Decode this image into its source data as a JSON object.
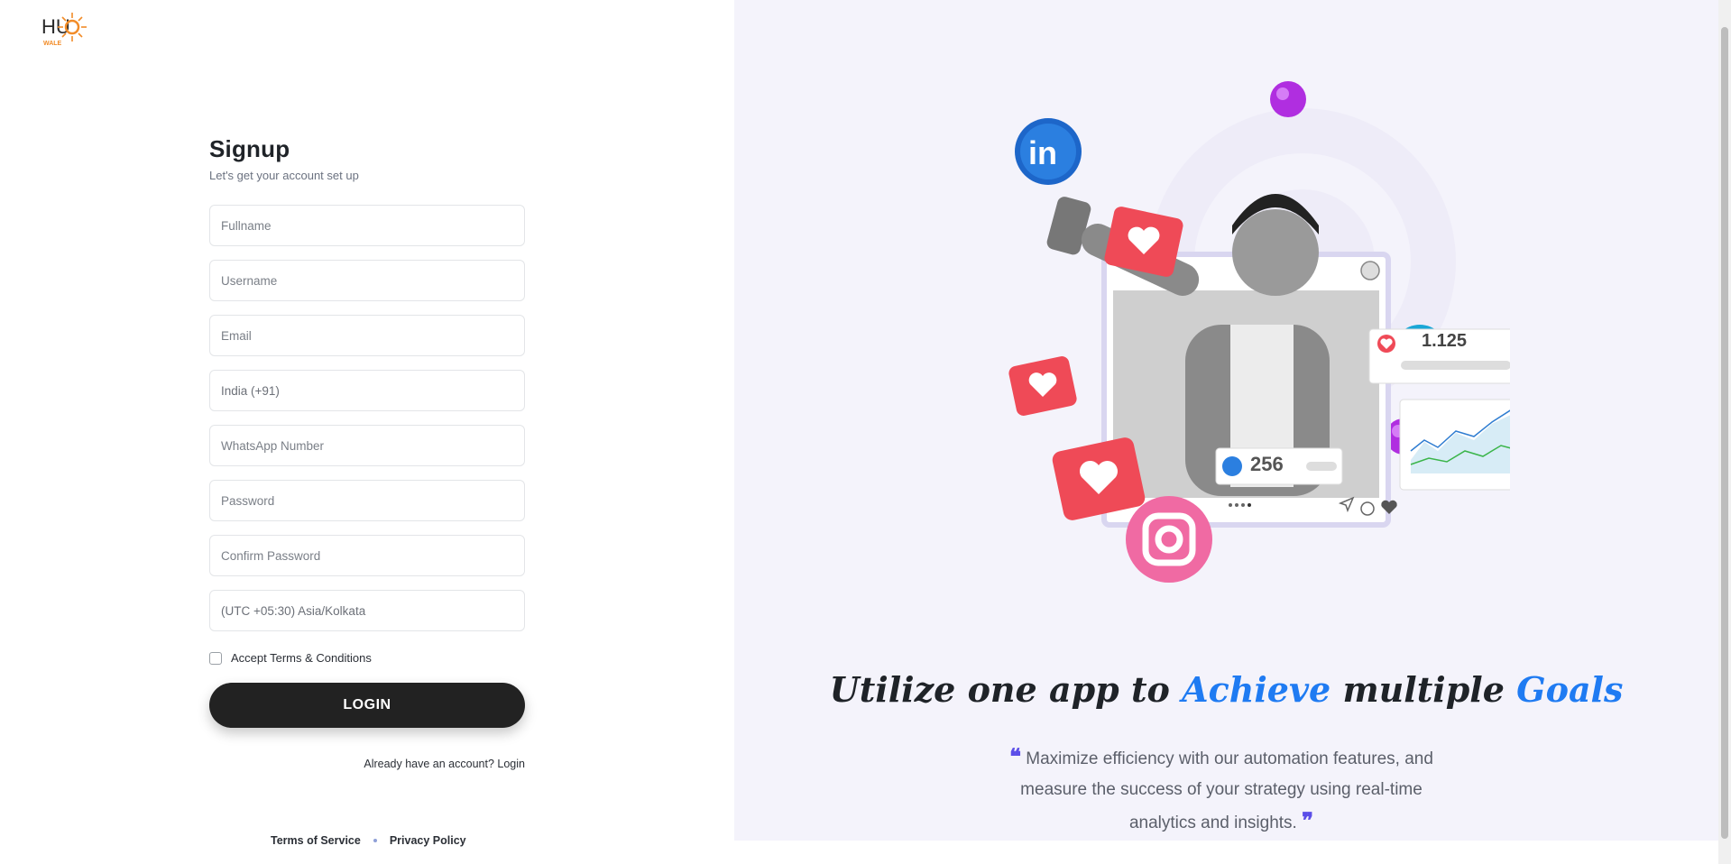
{
  "brand": {
    "logo_main": "HUb",
    "logo_sub": "WALE",
    "accent": "#f28c28"
  },
  "form": {
    "title": "Signup",
    "subtitle": "Let's get your account set up",
    "fields": {
      "fullname": "Fullname",
      "username": "Username",
      "email": "Email",
      "country": "India (+91)",
      "whatsapp": "WhatsApp Number",
      "password": "Password",
      "confirm_password": "Confirm Password",
      "timezone": "(UTC +05:30) Asia/Kolkata"
    },
    "terms_label": "Accept Terms & Conditions",
    "submit_label": "LOGIN",
    "already_text": "Already have an account?",
    "login_link": "Login"
  },
  "footer": {
    "terms": "Terms of Service",
    "privacy": "Privacy Policy"
  },
  "promo": {
    "headline_part1": "Utilize one app to",
    "headline_hl1": "Achieve",
    "headline_part2": "multiple",
    "headline_hl2": "Goals",
    "quote": "Maximize efficiency with our automation features, and measure the success of your strategy using real-time analytics and insights.",
    "likes_count": "1.125",
    "thumbs_count": "256"
  },
  "colors": {
    "button_bg": "#222222",
    "highlight_blue": "#1f7bf2",
    "heart_red": "#ef4a57",
    "panel_bg": "#f4f3fb"
  }
}
